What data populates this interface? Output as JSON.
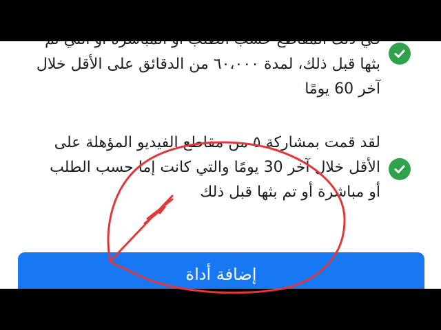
{
  "requirements": [
    {
      "lines": [
        "في ذلك المقاطع حسب الطلب أو المباشرة أو التي تم",
        "بثها قبل ذلك، لمدة ٦٠،٠٠٠ من الدقائق على الأقل خلال",
        "آخر 60 يومًا"
      ],
      "status_icon": "check-circle-icon",
      "status_color": "#31a24c"
    },
    {
      "lines": [
        "لقد قمت بمشاركة ٥ من مقاطع الفيديو المؤهلة على",
        "الأقل خلال آخر 30 يومًا والتي كانت إما حسب الطلب",
        "أو مباشرة أو تم بثها قبل ذلك"
      ],
      "status_icon": "check-circle-icon",
      "status_color": "#31a24c"
    }
  ],
  "primary_button": {
    "label": "إضافة أداة",
    "color": "#1877f2"
  },
  "annotation": {
    "color": "#e0373a"
  }
}
